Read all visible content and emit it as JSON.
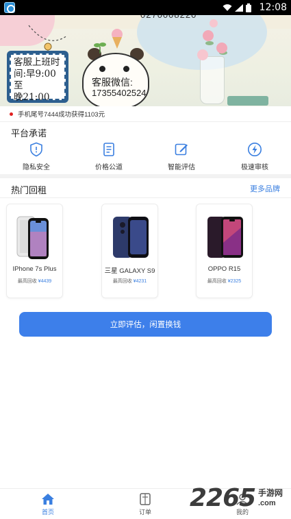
{
  "status_bar": {
    "time": "12:08",
    "icons": [
      "app-icon",
      "wifi-icon",
      "signal-icon",
      "battery-icon"
    ]
  },
  "banner": {
    "phone_partial": "0270008220",
    "sign_lines": [
      "客服上班时",
      "间:早9:00至",
      "晚21:00"
    ],
    "wechat_label": "客服微信:",
    "wechat_number": "17355402524"
  },
  "ticker": {
    "text": "手机尾号7444成功获得1103元"
  },
  "promises": {
    "title": "平台承诺",
    "items": [
      {
        "label": "隐私安全",
        "icon": "shield-icon"
      },
      {
        "label": "价格公道",
        "icon": "document-icon"
      },
      {
        "label": "智能评估",
        "icon": "edit-icon"
      },
      {
        "label": "极速审核",
        "icon": "lightning-icon"
      }
    ]
  },
  "hot": {
    "title": "热门回租",
    "more_label": "更多品牌",
    "products": [
      {
        "name": "IPhone 7s Plus",
        "price_label": "最高回收",
        "price": "¥4439"
      },
      {
        "name": "三星 GALAXY S9",
        "price_label": "最高回收",
        "price": "¥4231"
      },
      {
        "name": "OPPO R15",
        "price_label": "最高回收",
        "price": "¥2325"
      }
    ]
  },
  "cta": {
    "label": "立即评估，闲置换钱"
  },
  "tab_bar": {
    "tabs": [
      {
        "label": "首页",
        "icon": "home-icon",
        "active": true
      },
      {
        "label": "订单",
        "icon": "order-icon",
        "active": false
      },
      {
        "label": "我的",
        "icon": "profile-icon",
        "active": false
      }
    ]
  },
  "watermark": {
    "number": "2265",
    "text": "手游网",
    "url": ".com"
  },
  "colors": {
    "accent": "#3d7fea",
    "link": "#3a7fe0",
    "ticker_dot": "#e02020"
  }
}
